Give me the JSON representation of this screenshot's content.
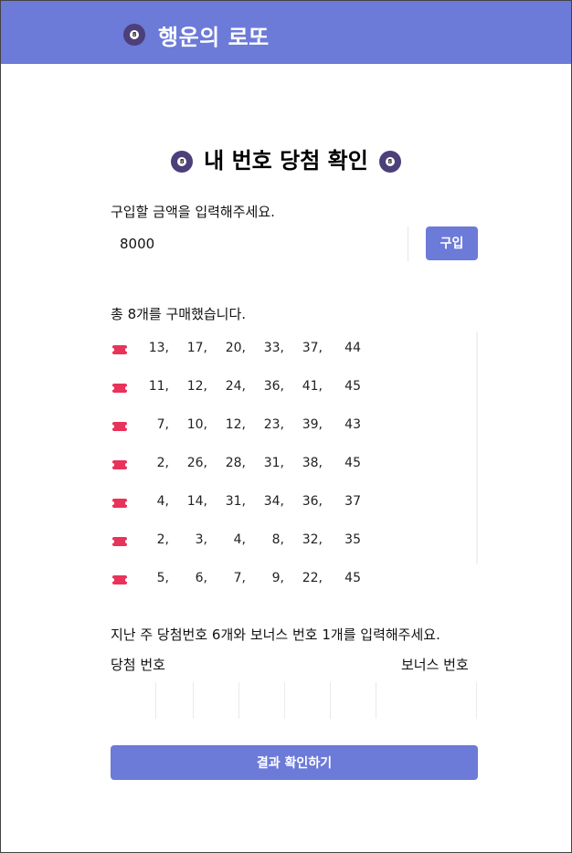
{
  "header": {
    "title": "행운의 로또",
    "icon": "lotto-ball-icon",
    "color": "#6c7ad8"
  },
  "main": {
    "title": "내 번호 당첨 확인"
  },
  "purchase": {
    "prompt": "구입할 금액을 입력해주세요.",
    "amount_value": "8000",
    "buy_label": "구입"
  },
  "tickets": {
    "summary": "총 8개를 구매했습니다.",
    "icon": "ticket-icon",
    "rows": [
      [
        13,
        17,
        20,
        33,
        37,
        44
      ],
      [
        11,
        12,
        24,
        36,
        41,
        45
      ],
      [
        7,
        10,
        12,
        23,
        39,
        43
      ],
      [
        2,
        26,
        28,
        31,
        38,
        45
      ],
      [
        4,
        14,
        31,
        34,
        36,
        37
      ],
      [
        2,
        3,
        4,
        8,
        32,
        35
      ],
      [
        5,
        6,
        7,
        9,
        22,
        45
      ]
    ]
  },
  "winning": {
    "prompt": "지난 주 당첨번호 6개와 보너스 번호 1개를 입력해주세요.",
    "winning_label": "당첨 번호",
    "bonus_label": "보너스 번호",
    "result_label": "결과 확인하기"
  }
}
